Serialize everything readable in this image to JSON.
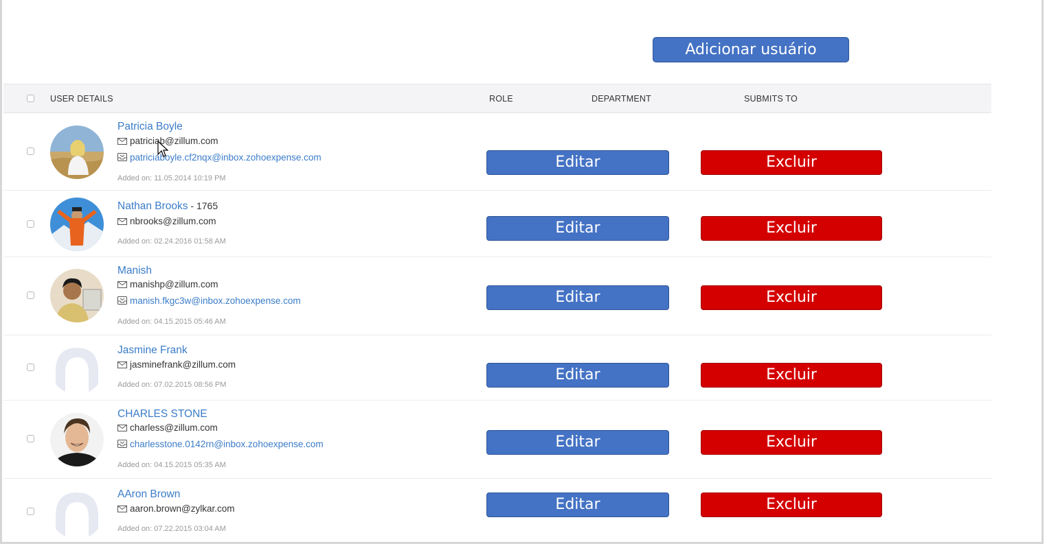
{
  "toolbar": {
    "add_user_label": "Adicionar usuário"
  },
  "table": {
    "headers": {
      "user_details": "USER DETAILS",
      "role": "ROLE",
      "department": "DEPARTMENT",
      "submits_to": "SUBMITS TO"
    },
    "actions": {
      "edit_label": "Editar",
      "delete_label": "Excluir"
    },
    "rows": [
      {
        "name": "Patricia Boyle",
        "email": "patriciab@zillum.com",
        "inbox": "patriciaboyle.cf2nqx@inbox.zohoexpense.com",
        "added": "Added on: 11.05.2014 10:19 PM",
        "avatar": "photo-woman-outdoor"
      },
      {
        "name": "Nathan Brooks",
        "suffix": " - 1765",
        "email": "nbrooks@zillum.com",
        "added": "Added on: 02.24.2016 01:58 AM",
        "avatar": "photo-man-mountain"
      },
      {
        "name": "Manish",
        "email": "manishp@zillum.com",
        "inbox": "manish.fkgc3w@inbox.zohoexpense.com",
        "added": "Added on: 04.15.2015 05:46 AM",
        "avatar": "photo-man-office"
      },
      {
        "name": "Jasmine Frank",
        "email": "jasminefrank@zillum.com",
        "added": "Added on: 07.02.2015 08:56 PM",
        "avatar": "placeholder-avatar"
      },
      {
        "name": "CHARLES STONE",
        "email": "charless@zillum.com",
        "inbox": "charlesstone.0142rn@inbox.zohoexpense.com",
        "added": "Added on: 04.15.2015 05:35 AM",
        "avatar": "photo-man-smiling"
      },
      {
        "name": "AAron Brown",
        "email": "aaron.brown@zylkar.com",
        "added": "Added on: 07.22.2015 03:04 AM",
        "avatar": "placeholder-avatar"
      }
    ]
  },
  "colors": {
    "primary_button": "#4472c4",
    "danger_button": "#d40000",
    "link": "#3b7cc8"
  }
}
